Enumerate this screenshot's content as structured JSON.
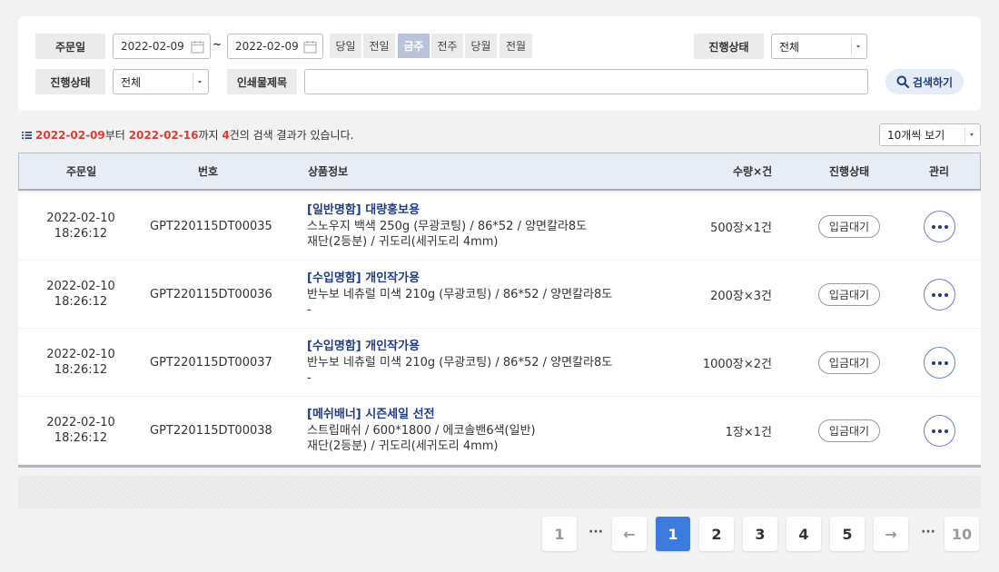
{
  "filters": {
    "order_date_label": "주문일",
    "date_from": "2022-02-09",
    "date_to": "2022-02-09",
    "range_sep": "~",
    "quick_buttons": [
      "당일",
      "전일",
      "금주",
      "전주",
      "당월",
      "전월"
    ],
    "active_quick": "금주",
    "status_label_1": "진행상태",
    "status_value_1": "전체",
    "status_label_2": "진행상태",
    "status_value_2": "전체",
    "print_title_label": "인쇄물제목",
    "print_title_value": "",
    "search_label": "검색하기"
  },
  "summary": {
    "from": "2022-02-09",
    "from_suffix": "부터",
    "to": "2022-02-16",
    "to_suffix": "까지",
    "count": "4",
    "count_suffix": "건의 검색 결과가 있습니다.",
    "view_option": "10개씩 보기"
  },
  "table": {
    "headers": {
      "date": "주문일",
      "number": "번호",
      "product": "상품정보",
      "qty": "수량×건",
      "status": "진행상태",
      "manage": "관리"
    },
    "rows": [
      {
        "date": "2022-02-10",
        "time": "18:26:12",
        "number": "GPT220115DT00035",
        "title": "[일반명함] 대량홍보용",
        "line1": "스노우지 백색 250g (무광코팅) / 86*52 / 양면칼라8도",
        "line2": "재단(2등분) / 귀도리(세귀도리 4mm)",
        "qty": "500장×1건",
        "status": "입금대기"
      },
      {
        "date": "2022-02-10",
        "time": "18:26:12",
        "number": "GPT220115DT00036",
        "title": "[수입명함] 개인작가용",
        "line1": "반누보 네츄럴 미색 210g (무광코팅) / 86*52 / 양면칼라8도",
        "line2": "-",
        "qty": "200장×3건",
        "status": "입금대기"
      },
      {
        "date": "2022-02-10",
        "time": "18:26:12",
        "number": "GPT220115DT00037",
        "title": "[수입명함] 개인작가용",
        "line1": "반누보 네츄럴 미색 210g (무광코팅) / 86*52 / 양면칼라8도",
        "line2": "-",
        "qty": "1000장×2건",
        "status": "입금대기"
      },
      {
        "date": "2022-02-10",
        "time": "18:26:12",
        "number": "GPT220115DT00038",
        "title": "[메쉬배너] 시즌세일 선전",
        "line1": "스트립매쉬 / 600*1800 / 에코솔밴6색(일반)",
        "line2": "재단(2등분) / 귀도리(세귀도리 4mm)",
        "qty": "1장×1건",
        "status": "입금대기"
      }
    ]
  },
  "pagination": {
    "first": "1",
    "ellipsis": "···",
    "prev": "←",
    "pages": [
      "1",
      "2",
      "3",
      "4",
      "5"
    ],
    "current": "1",
    "next": "→",
    "last": "10"
  },
  "colors": {
    "accent": "#3b7bdc",
    "title_blue": "#1f3c88",
    "highlight_red": "#e03c31",
    "active_quick_bg": "#b9c3dc"
  }
}
